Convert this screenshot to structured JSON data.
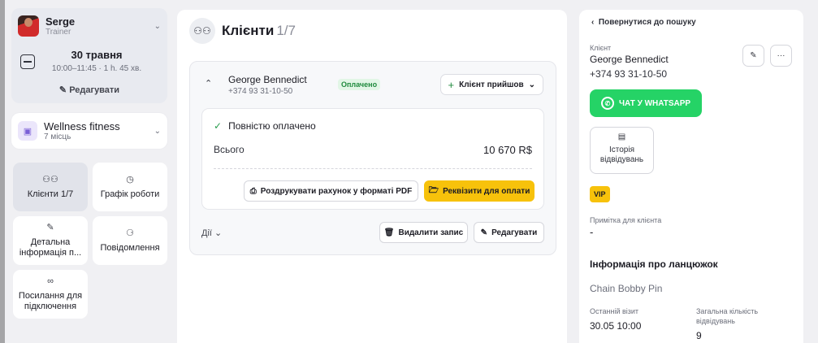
{
  "staff": {
    "name": "Serge",
    "role": "Trainer"
  },
  "appointment": {
    "date": "30 травня",
    "time": "10:00–11:45 · 1 h. 45 хв.",
    "edit_label": "Редагувати"
  },
  "service": {
    "name": "Wellness fitness",
    "seats": "7 місць"
  },
  "tiles": [
    {
      "label": "Клієнти 1/7",
      "icon": "users-icon"
    },
    {
      "label": "Графік роботи",
      "icon": "clock-icon"
    },
    {
      "label": "Детальна інформація п...",
      "icon": "document-edit-icon"
    },
    {
      "label": "Повідомлення",
      "icon": "bell-icon"
    },
    {
      "label": "Посилання для підключення",
      "icon": "link-icon"
    }
  ],
  "middle": {
    "title": "Клієнти",
    "count": "1/7",
    "client": {
      "name": "George Bennedict",
      "phone": "+374 93 31-10-50",
      "status_badge": "Оплачено",
      "arrived_label": "Клієнт прийшов"
    },
    "payment": {
      "status": "Повністю оплачено",
      "total_label": "Всього",
      "total_value": "10 670 R$",
      "print_label": "Роздрукувати рахунок у форматі PDF",
      "requisites_label": "Реквізити для оплати"
    },
    "actions_label": "Дії",
    "delete_label": "Видалити запис",
    "edit_label": "Редагувати"
  },
  "right": {
    "back_label": "Повернутися до пошуку",
    "client_label": "Клієнт",
    "client_name": "George Bennedict",
    "client_phone": "+374 93 31-10-50",
    "whatsapp_label": "ЧАТ У WHATSAPP",
    "history_label": "Історія відвідувань",
    "vip_label": "VIP",
    "note_label": "Примітка для клієнта",
    "note_value": "-",
    "chain_title": "Інформація про ланцюжок",
    "chain_name": "Chain Bobby Pin",
    "last_visit_label": "Останній візит",
    "last_visit_value": "30.05 10:00",
    "total_visits_label": "Загальна кількість відвідувань",
    "total_visits_value": "9"
  },
  "colors": {
    "accent_yellow": "#f7c20b",
    "whatsapp_green": "#25d366",
    "paid_green": "#1f8a3d"
  }
}
